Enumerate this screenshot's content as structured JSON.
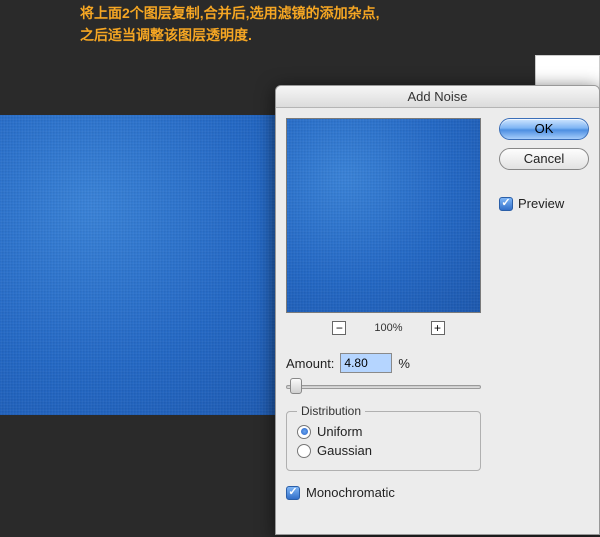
{
  "instruction": {
    "line1": "将上面2个图层复制,合并后,选用滤镜的添加杂点,",
    "line2": "之后适当调整该图层透明度."
  },
  "dialog": {
    "title": "Add Noise",
    "zoom": {
      "level": "100%"
    },
    "amount": {
      "label": "Amount:",
      "value": "4.80",
      "unit": "%"
    },
    "distribution": {
      "title": "Distribution",
      "uniform": "Uniform",
      "gaussian": "Gaussian",
      "selected": "uniform"
    },
    "monochromatic": {
      "label": "Monochromatic",
      "checked": true
    },
    "buttons": {
      "ok": "OK",
      "cancel": "Cancel"
    },
    "preview": {
      "label": "Preview",
      "checked": true
    }
  }
}
